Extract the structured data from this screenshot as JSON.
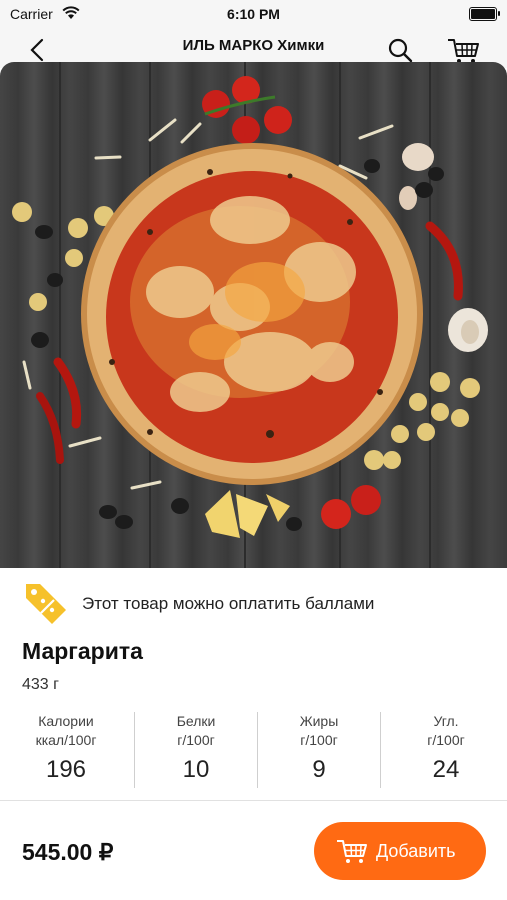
{
  "status_bar": {
    "carrier": "Carrier",
    "time": "6:10 PM"
  },
  "nav": {
    "title": "ИЛЬ МАРКО Химки"
  },
  "product": {
    "points_text": "Этот товар можно оплатить баллами",
    "name": "Маргарита",
    "weight": "433 г",
    "nutrition": [
      {
        "label_line1": "Калории",
        "label_line2": "ккал/100г",
        "value": "196"
      },
      {
        "label_line1": "Белки",
        "label_line2": "г/100г",
        "value": "10"
      },
      {
        "label_line1": "Жиры",
        "label_line2": "г/100г",
        "value": "9"
      },
      {
        "label_line1": "Угл.",
        "label_line2": "г/100г",
        "value": "24"
      }
    ],
    "price": "545.00 ₽"
  },
  "actions": {
    "add_label": "Добавить"
  },
  "colors": {
    "accent": "#ff6a13",
    "badge": "#f6c12b"
  }
}
